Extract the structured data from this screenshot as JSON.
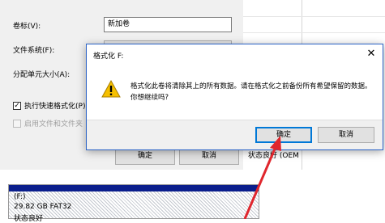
{
  "background_dialog": {
    "fields": [
      {
        "label": "卷标(V):",
        "value": "新加卷"
      },
      {
        "label": "文件系统(F):"
      },
      {
        "label": "分配单元大小(A):"
      }
    ],
    "quick_format_label": "执行快速格式化(P)",
    "quick_format_checked": true,
    "compress_label": "启用文件和文件夹",
    "ok_label": "确定",
    "cancel_label": "取消"
  },
  "explorer": {
    "status_text": "状态良好 (OEM"
  },
  "disk_map": {
    "name": "(F:)",
    "size": "29.82 GB FAT32",
    "status": "状态良好"
  },
  "dialog": {
    "title": "格式化 F:",
    "message": "格式化此卷将清除其上的所有数据。请在格式化之前备份所有希望保留的数据。你想继续吗?",
    "ok_label": "确定",
    "cancel_label": "取消",
    "close_glyph": "✕",
    "icon": "warning-icon"
  },
  "colors": {
    "dialog_border": "#2b63c6",
    "primary_button_border": "#0078d7",
    "disk_bar": "#0a1e8c",
    "arrow": "#e0262d",
    "warning_fill": "#f6c000"
  }
}
